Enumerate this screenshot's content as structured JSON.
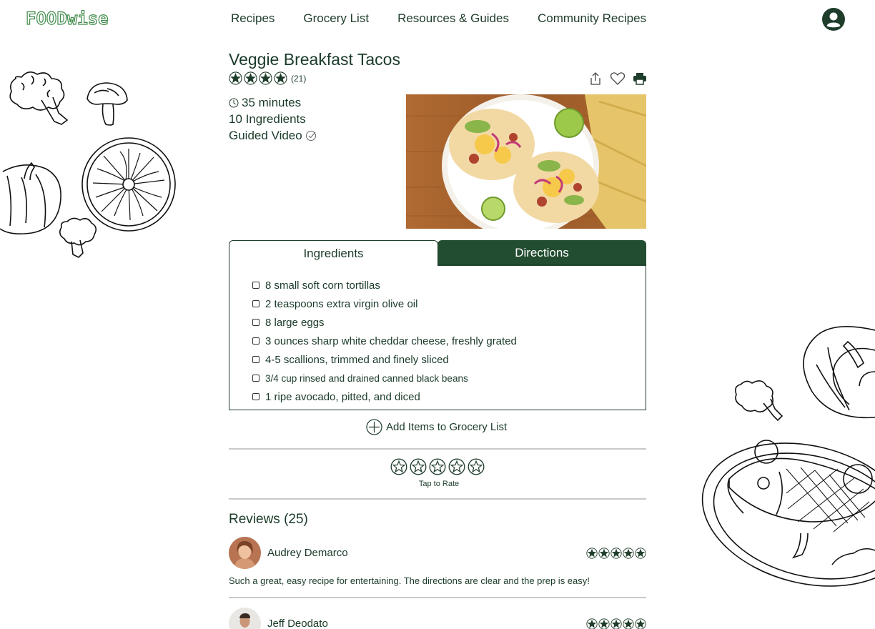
{
  "header": {
    "logo": "FOODwise",
    "nav": [
      "Recipes",
      "Grocery List",
      "Resources & Guides",
      "Community Recipes"
    ],
    "account_icon": "account-circle-icon"
  },
  "recipe": {
    "title": "Veggie Breakfast Tacos",
    "rating_stars": 4,
    "rating_count": "(21)",
    "time": "35 minutes",
    "ingredients_count": "10 Ingredients",
    "video": "Guided Video",
    "action_icons": [
      "share-icon",
      "heart-icon",
      "print-icon"
    ]
  },
  "tabs": {
    "ingredients": "Ingredients",
    "directions": "Directions"
  },
  "ingredients": [
    "8 small soft corn tortillas",
    "2 teaspoons extra virgin olive oil",
    "8 large eggs",
    "3 ounces sharp white cheddar cheese, freshly grated",
    "4-5 scallions, trimmed and finely sliced",
    "3/4 cup rinsed and drained canned black beans",
    "1 ripe avocado, pitted, and diced"
  ],
  "add_to_grocery": "Add Items to Grocery List",
  "rate": {
    "stars": 5,
    "label": "Tap to Rate"
  },
  "reviews": {
    "title": "Reviews (25)",
    "items": [
      {
        "name": "Audrey Demarco",
        "stars": 5,
        "text": "Such a great, easy recipe for entertaining. The directions are clear and the prep is easy!"
      },
      {
        "name": "Jeff Deodato",
        "stars": 5,
        "text": ""
      }
    ]
  },
  "colors": {
    "brand_green": "#224d31",
    "logo_green": "#3f8a4a",
    "text": "#1a3a28",
    "divider": "#c9c9c9"
  }
}
